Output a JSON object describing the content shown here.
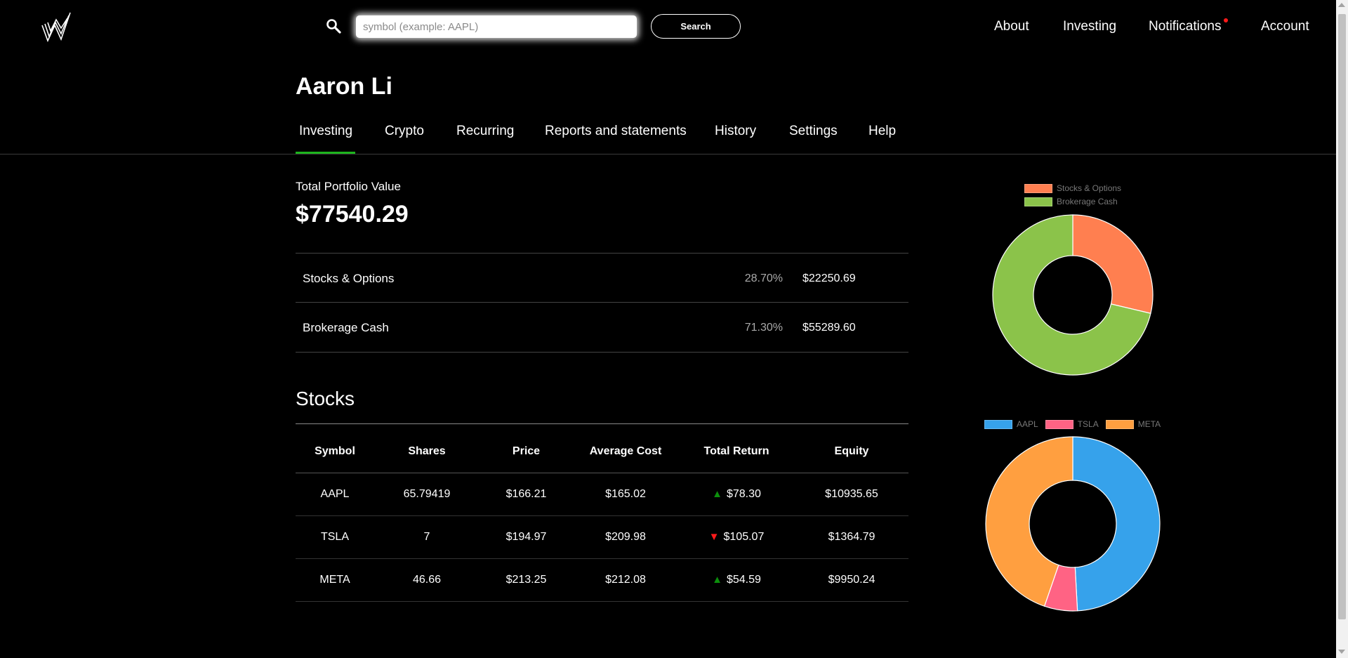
{
  "search": {
    "placeholder": "symbol (example: AAPL)",
    "value": "",
    "button_label": "Search",
    "icon": "search-icon"
  },
  "topnav": {
    "about": "About",
    "investing": "Investing",
    "notifications": "Notifications",
    "account": "Account"
  },
  "user": {
    "name": "Aaron Li"
  },
  "tabs": [
    "Investing",
    "Crypto",
    "Recurring",
    "Reports and statements",
    "History",
    "Settings",
    "Help"
  ],
  "active_tab": "Investing",
  "portfolio": {
    "label": "Total Portfolio Value",
    "value": "$77540.29",
    "allocations": [
      {
        "name": "Stocks & Options",
        "pct": "28.70%",
        "amount": "$22250.69"
      },
      {
        "name": "Brokerage Cash",
        "pct": "71.30%",
        "amount": "$55289.60"
      }
    ]
  },
  "stocks": {
    "heading": "Stocks",
    "headers": [
      "Symbol",
      "Shares",
      "Price",
      "Average Cost",
      "Total Return",
      "Equity"
    ],
    "rows": [
      {
        "symbol": "AAPL",
        "shares": "65.79419",
        "price": "$166.21",
        "avg_cost": "$165.02",
        "direction": "up",
        "total_return": "$78.30",
        "equity": "$10935.65"
      },
      {
        "symbol": "TSLA",
        "shares": "7",
        "price": "$194.97",
        "avg_cost": "$209.98",
        "direction": "down",
        "total_return": "$105.07",
        "equity": "$1364.79"
      },
      {
        "symbol": "META",
        "shares": "46.66",
        "price": "$213.25",
        "avg_cost": "$212.08",
        "direction": "up",
        "total_return": "$54.59",
        "equity": "$9950.24"
      }
    ]
  },
  "colors": {
    "background": "#000000",
    "active_tab": "#1db41d",
    "up": "#0c8f0c",
    "down": "#ff1a1a",
    "notification_dot": "#ff1a1a"
  },
  "chart_data": [
    {
      "type": "pie",
      "variant": "doughnut",
      "legend_position": "top",
      "categories": [
        "Stocks & Options",
        "Brokerage Cash"
      ],
      "values": [
        22250.69,
        55289.6
      ],
      "colors": [
        "#ff7f50",
        "#8bc34a"
      ]
    },
    {
      "type": "pie",
      "variant": "doughnut",
      "legend_position": "top",
      "categories": [
        "AAPL",
        "TSLA",
        "META"
      ],
      "values": [
        10935.65,
        1364.79,
        9950.24
      ],
      "colors": [
        "#36a2eb",
        "#ff6384",
        "#ff9f40"
      ]
    }
  ]
}
